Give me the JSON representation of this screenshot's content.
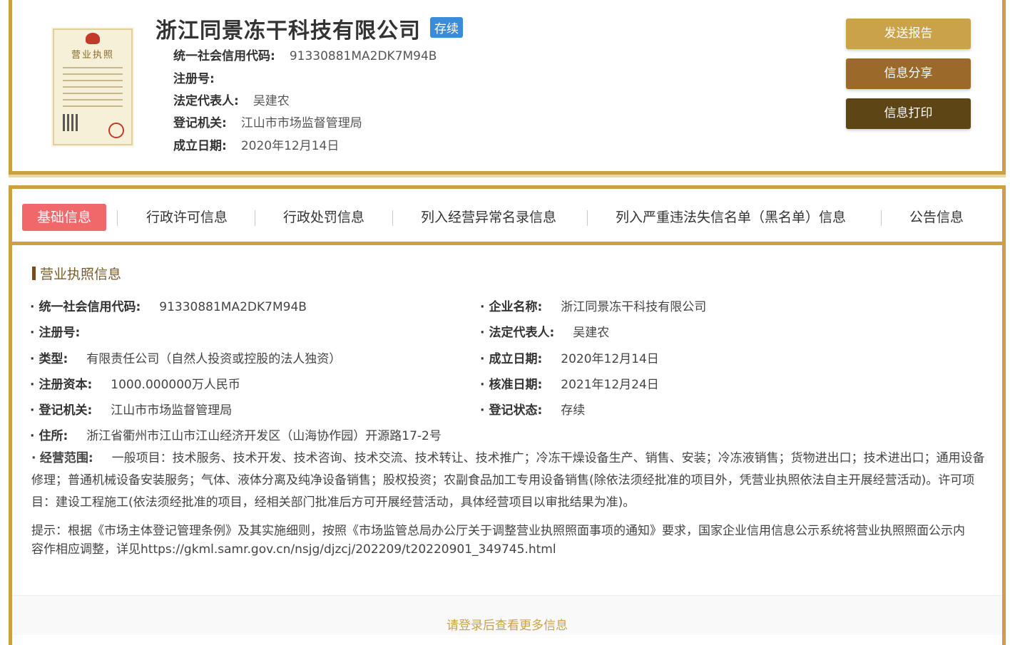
{
  "company": {
    "name": "浙江同景冻干科技有限公司",
    "status": "存续"
  },
  "header_fields": [
    {
      "label": "统一社会信用代码:",
      "value": "91330881MA2DK7M94B"
    },
    {
      "label": "注册号:",
      "value": ""
    },
    {
      "label": "法定代表人:",
      "value": "吴建农"
    },
    {
      "label": "登记机关:",
      "value": "江山市市场监督管理局"
    },
    {
      "label": "成立日期:",
      "value": "2020年12月14日"
    }
  ],
  "license_thumb": {
    "title": "营业执照"
  },
  "actions": {
    "send_report": "发送报告",
    "share": "信息分享",
    "print": "信息打印"
  },
  "colors": {
    "accent_gold": "#caa040",
    "send_btn": "#c9a24a",
    "share_btn": "#9b6a2a",
    "print_btn": "#5e4516",
    "active_tab": "#f0686a",
    "status_badge": "#3a8bd9"
  },
  "tabs": [
    {
      "label": "基础信息",
      "active": true
    },
    {
      "label": "行政许可信息"
    },
    {
      "label": "行政处罚信息"
    },
    {
      "label": "列入经营异常名录信息"
    },
    {
      "label": "列入严重违法失信名单（黑名单）信息"
    },
    {
      "label": "公告信息"
    }
  ],
  "section": {
    "title": "营业执照信息"
  },
  "details": {
    "credit_code": {
      "label": "统一社会信用代码:",
      "value": "91330881MA2DK7M94B"
    },
    "company_name": {
      "label": "企业名称:",
      "value": "浙江同景冻干科技有限公司"
    },
    "reg_no": {
      "label": "注册号:",
      "value": ""
    },
    "legal_rep": {
      "label": "法定代表人:",
      "value": "吴建农"
    },
    "type": {
      "label": "类型:",
      "value": "有限责任公司（自然人投资或控股的法人独资）"
    },
    "est_date": {
      "label": "成立日期:",
      "value": "2020年12月14日"
    },
    "capital": {
      "label": "注册资本:",
      "value": "1000.000000万人民币"
    },
    "approve_date": {
      "label": "核准日期:",
      "value": "2021年12月24日"
    },
    "authority": {
      "label": "登记机关:",
      "value": "江山市市场监督管理局"
    },
    "reg_status": {
      "label": "登记状态:",
      "value": "存续"
    },
    "address": {
      "label": "住所:",
      "value": "浙江省衢州市江山市江山经济开发区（山海协作园）开源路17-2号"
    },
    "scope_label": "经营范围:",
    "scope_value": "一般项目：技术服务、技术开发、技术咨询、技术交流、技术转让、技术推广；冷冻干燥设备生产、销售、安装；冷冻液销售；货物进出口；技术进出口；通用设备修理；普通机械设备安装服务；气体、液体分离及纯净设备销售；股权投资；农副食品加工专用设备销售(除依法须经批准的项目外，凭营业执照依法自主开展经营活动)。许可项目：建设工程施工(依法须经批准的项目，经相关部门批准后方可开展经营活动，具体经营项目以审批结果为准)。"
  },
  "notice": "提示：根据《市场主体登记管理条例》及其实施细则，按照《市场监管总局办公厅关于调整营业执照照面事项的通知》要求，国家企业信用信息公示系统将营业执照照面公示内容作相应调整，详见https://gkml.samr.gov.cn/nsjg/djzcj/202209/t20220901_349745.html",
  "more_link": "请登录后查看更多信息"
}
